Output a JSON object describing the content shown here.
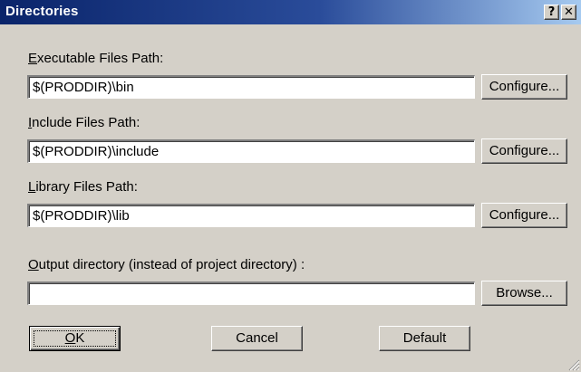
{
  "window": {
    "title": "Directories",
    "help_label": "?",
    "close_label": "✕"
  },
  "executable": {
    "label_mnemonic": "E",
    "label_rest": "xecutable Files Path:",
    "value": "$(PRODDIR)\\bin",
    "button_label": "Configure..."
  },
  "include": {
    "label_mnemonic": "I",
    "label_rest": "nclude Files Path:",
    "value": "$(PRODDIR)\\include",
    "button_label": "Configure..."
  },
  "library": {
    "label_mnemonic": "L",
    "label_rest": "ibrary Files Path:",
    "value": "$(PRODDIR)\\lib",
    "button_label": "Configure..."
  },
  "output": {
    "label_mnemonic": "O",
    "label_rest": "utput directory (instead of project directory) :",
    "value": "",
    "button_label": "Browse..."
  },
  "footer": {
    "ok_mnemonic": "O",
    "ok_rest": "K",
    "cancel_label": "Cancel",
    "default_label": "Default"
  },
  "colors": {
    "title_bar_start": "#0a246a",
    "title_bar_end": "#a6caf0",
    "face": "#d4d0c8"
  }
}
